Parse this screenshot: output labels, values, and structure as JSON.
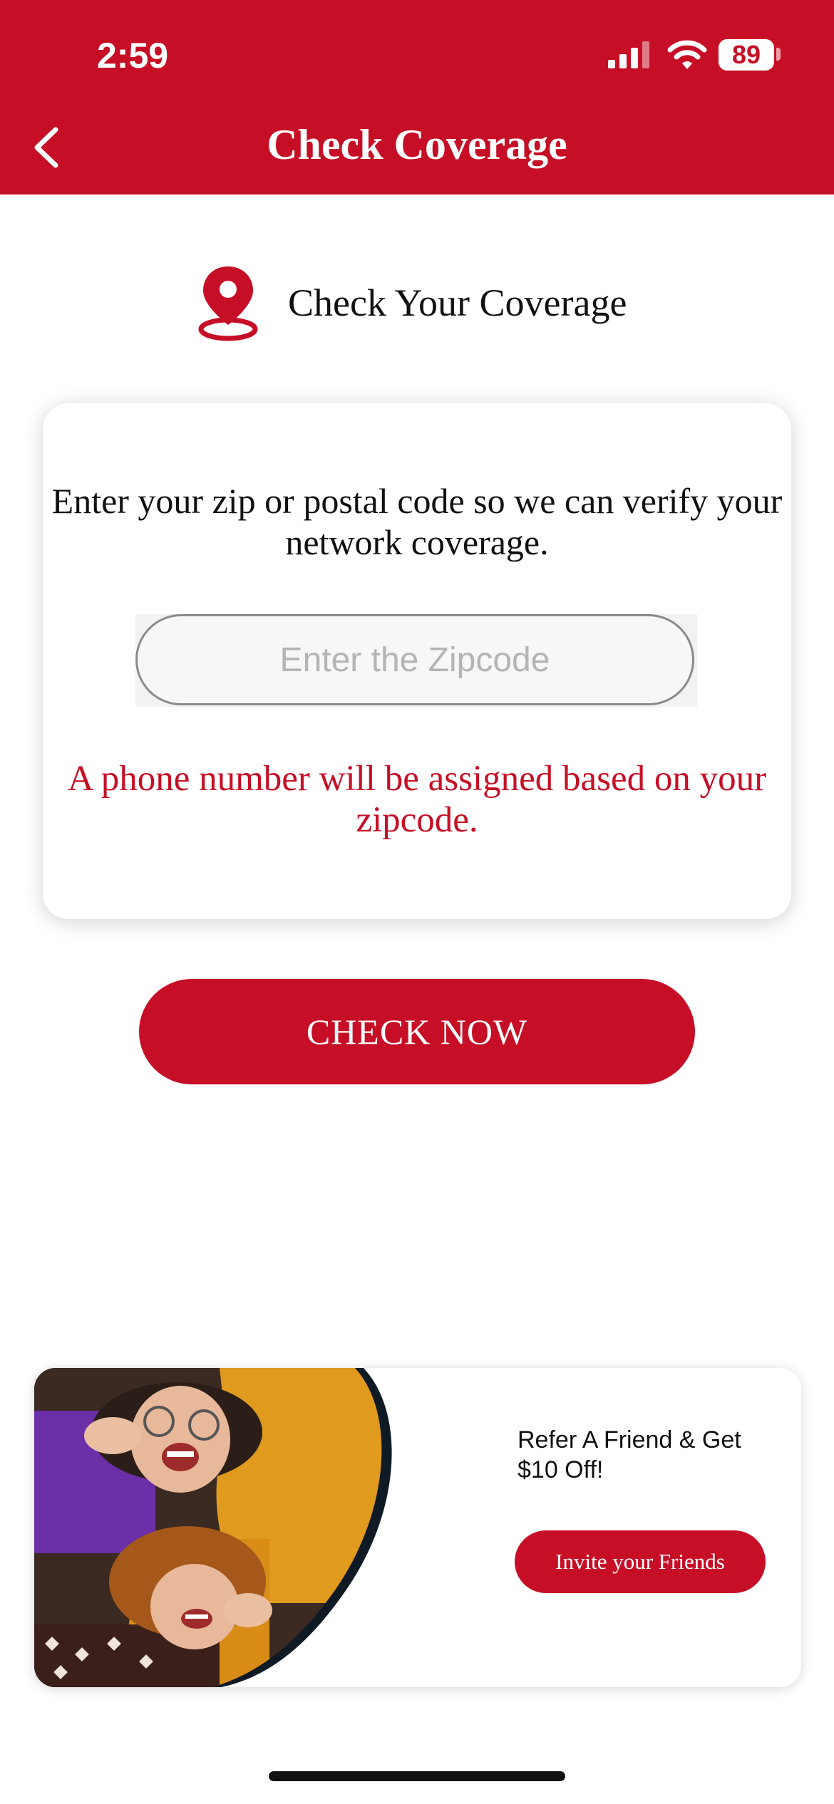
{
  "status_bar": {
    "time": "2:59",
    "battery": "89",
    "icons": [
      "signal-icon",
      "wifi-icon",
      "battery-icon"
    ]
  },
  "nav": {
    "title": "Check Coverage",
    "back_icon": "chevron-left-icon"
  },
  "section": {
    "icon": "location-pin-icon",
    "title": "Check Your Coverage"
  },
  "card": {
    "description": "Enter your zip or postal code so we can verify your network coverage.",
    "zip_input": {
      "value": "",
      "placeholder": "Enter the Zipcode"
    },
    "note": "A phone number will be assigned based on your zipcode."
  },
  "check_button": {
    "label": "CHECK NOW"
  },
  "promo": {
    "image": "two-smiling-women-photo",
    "text": "Refer A Friend & Get $10 Off!",
    "button_label": "Invite your Friends"
  },
  "colors": {
    "brand": "#c60f26",
    "background": "#ffffff"
  }
}
